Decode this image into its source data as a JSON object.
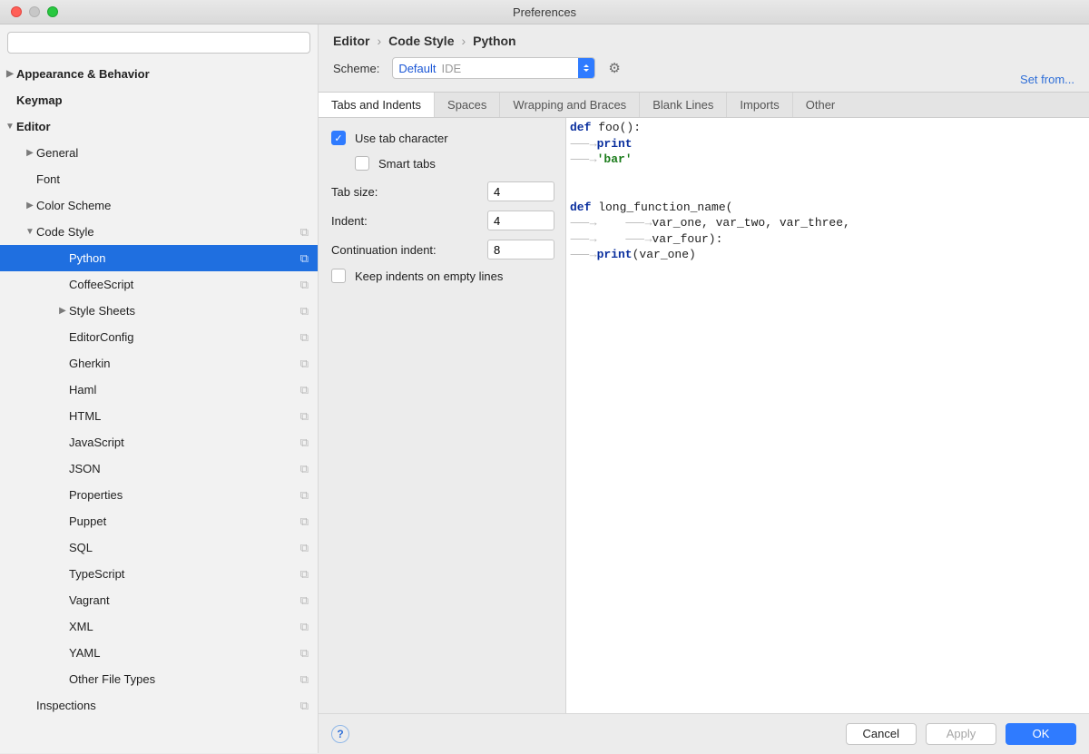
{
  "window": {
    "title": "Preferences"
  },
  "search": {
    "placeholder": ""
  },
  "sidebar": {
    "items": [
      {
        "label": "Appearance & Behavior",
        "level": 0,
        "arrow": "▶",
        "copy": false
      },
      {
        "label": "Keymap",
        "level": 0,
        "arrow": "",
        "copy": false
      },
      {
        "label": "Editor",
        "level": 0,
        "arrow": "▼",
        "copy": false
      },
      {
        "label": "General",
        "level": 1,
        "arrow": "▶",
        "copy": false
      },
      {
        "label": "Font",
        "level": 1,
        "arrow": "",
        "copy": false
      },
      {
        "label": "Color Scheme",
        "level": 1,
        "arrow": "▶",
        "copy": false
      },
      {
        "label": "Code Style",
        "level": 1,
        "arrow": "▼",
        "copy": true
      },
      {
        "label": "Python",
        "level": 2,
        "arrow": "",
        "copy": true,
        "selected": true
      },
      {
        "label": "CoffeeScript",
        "level": 2,
        "arrow": "",
        "copy": true
      },
      {
        "label": "Style Sheets",
        "level": 2,
        "arrow": "▶",
        "copy": true
      },
      {
        "label": "EditorConfig",
        "level": 2,
        "arrow": "",
        "copy": true
      },
      {
        "label": "Gherkin",
        "level": 2,
        "arrow": "",
        "copy": true
      },
      {
        "label": "Haml",
        "level": 2,
        "arrow": "",
        "copy": true
      },
      {
        "label": "HTML",
        "level": 2,
        "arrow": "",
        "copy": true
      },
      {
        "label": "JavaScript",
        "level": 2,
        "arrow": "",
        "copy": true
      },
      {
        "label": "JSON",
        "level": 2,
        "arrow": "",
        "copy": true
      },
      {
        "label": "Properties",
        "level": 2,
        "arrow": "",
        "copy": true
      },
      {
        "label": "Puppet",
        "level": 2,
        "arrow": "",
        "copy": true
      },
      {
        "label": "SQL",
        "level": 2,
        "arrow": "",
        "copy": true
      },
      {
        "label": "TypeScript",
        "level": 2,
        "arrow": "",
        "copy": true
      },
      {
        "label": "Vagrant",
        "level": 2,
        "arrow": "",
        "copy": true
      },
      {
        "label": "XML",
        "level": 2,
        "arrow": "",
        "copy": true
      },
      {
        "label": "YAML",
        "level": 2,
        "arrow": "",
        "copy": true
      },
      {
        "label": "Other File Types",
        "level": 2,
        "arrow": "",
        "copy": true
      },
      {
        "label": "Inspections",
        "level": 1,
        "arrow": "",
        "copy": true
      }
    ]
  },
  "breadcrumb": {
    "a": "Editor",
    "b": "Code Style",
    "c": "Python"
  },
  "scheme": {
    "label": "Scheme:",
    "value": "Default",
    "suffix": "IDE",
    "setfrom": "Set from..."
  },
  "tabs": [
    "Tabs and Indents",
    "Spaces",
    "Wrapping and Braces",
    "Blank Lines",
    "Imports",
    "Other"
  ],
  "options": {
    "use_tab_character": {
      "label": "Use tab character",
      "checked": true
    },
    "smart_tabs": {
      "label": "Smart tabs",
      "checked": false
    },
    "tab_size": {
      "label": "Tab size:",
      "value": "4"
    },
    "indent": {
      "label": "Indent:",
      "value": "4"
    },
    "continuation": {
      "label": "Continuation indent:",
      "value": "8"
    },
    "keep_indents": {
      "label": "Keep indents on empty lines",
      "checked": false
    }
  },
  "preview": {
    "l1a": "def",
    "l1b": " foo():",
    "l2a": "print",
    "l3a": "'bar'",
    "l5a": "def",
    "l5b": " long_function_name(",
    "l6": "var_one, var_two, var_three,",
    "l7": "var_four):",
    "l8a": "print",
    "l8b": "(var_one)"
  },
  "footer": {
    "cancel": "Cancel",
    "apply": "Apply",
    "ok": "OK"
  }
}
